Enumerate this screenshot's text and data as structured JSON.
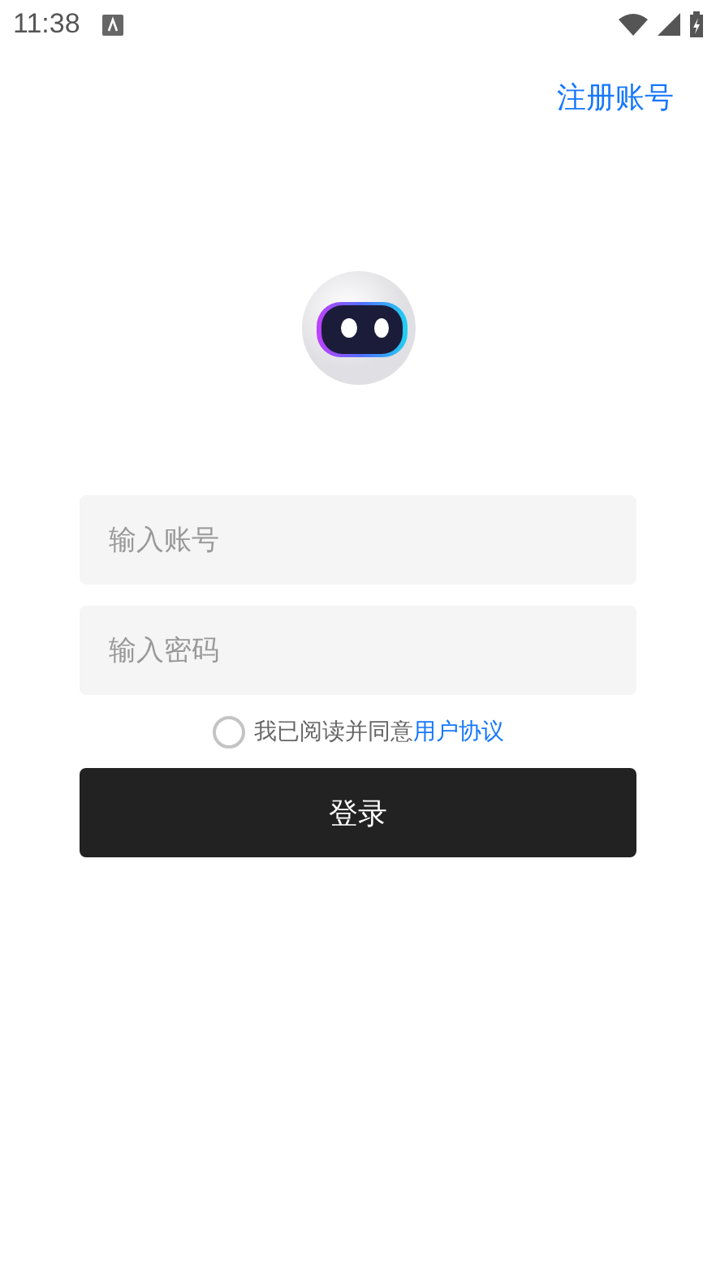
{
  "status_bar": {
    "time": "11:38"
  },
  "register_link": "注册账号",
  "fields": [
    {
      "placeholder": "输入账号"
    },
    {
      "placeholder": "输入密码"
    }
  ],
  "agreement": {
    "checked": false,
    "text": "我已阅读并同意",
    "link": "用户协议"
  },
  "login_button": "登录"
}
